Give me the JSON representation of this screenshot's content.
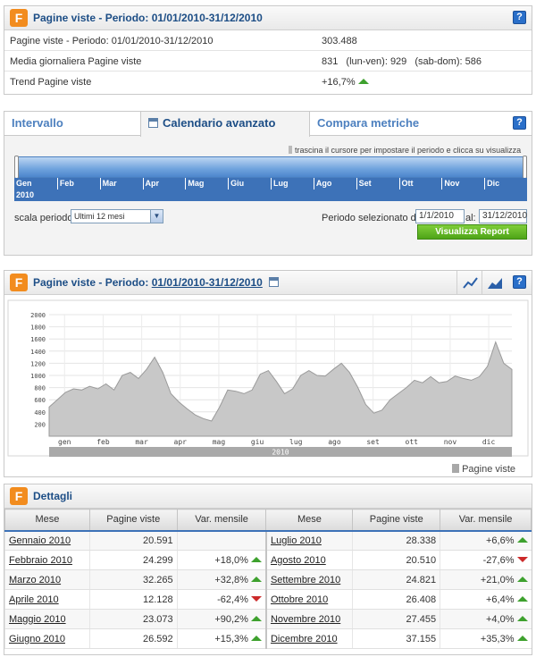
{
  "summary": {
    "title": "Pagine viste - Periodo: 01/01/2010-31/12/2010",
    "help": "?",
    "rows": [
      {
        "label": "Pagine viste - Periodo: 01/01/2010-31/12/2010",
        "value": "303.488"
      },
      {
        "label": "Media giornaliera Pagine viste",
        "value": "831",
        "weekdays": "(lun-ven): 929",
        "weekend": "(sab-dom): 586"
      },
      {
        "label": "Trend Pagine viste",
        "value": "+16,7%"
      }
    ]
  },
  "calendar": {
    "tabs": [
      "Intervallo",
      "Calendario avanzato",
      "Compara metriche"
    ],
    "help": "?",
    "hint": "trascina il cursore per impostare il periodo e clicca su visualizza report",
    "months": [
      "Gen",
      "Feb",
      "Mar",
      "Apr",
      "Mag",
      "Giu",
      "Lug",
      "Ago",
      "Set",
      "Ott",
      "Nov",
      "Dic"
    ],
    "year": "2010",
    "scale_label": "scala periodo:",
    "scale_value": "Ultimi 12 mesi",
    "period_label": "Periodo selezionato dal:",
    "date_from": "1/1/2010",
    "al_label": "al:",
    "date_to": "31/12/2010",
    "button": "Visualizza Report"
  },
  "chart_panel": {
    "title_prefix": "Pagine viste - Periodo:",
    "title_period": "01/01/2010-31/12/2010",
    "help": "?",
    "legend": "Pagine viste"
  },
  "chart_data": {
    "type": "area",
    "title": "",
    "ylim": [
      0,
      2000
    ],
    "yticks": [
      200,
      400,
      600,
      800,
      1000,
      1200,
      1400,
      1600,
      1800,
      2000
    ],
    "xtick_labels": [
      "gen",
      "feb",
      "mar",
      "apr",
      "mag",
      "giu",
      "lug",
      "ago",
      "set",
      "ott",
      "nov",
      "dic"
    ],
    "x_label_bar": "2010",
    "series": [
      {
        "name": "Pagine viste",
        "color": "#c8c8c8",
        "x_start": "2010-01-01",
        "x_step_days": 7,
        "values": [
          480,
          600,
          720,
          780,
          760,
          820,
          780,
          860,
          760,
          1000,
          1050,
          950,
          1100,
          1300,
          1050,
          700,
          560,
          450,
          350,
          290,
          250,
          480,
          760,
          740,
          700,
          760,
          1020,
          1080,
          900,
          700,
          780,
          1000,
          1080,
          1000,
          990,
          1100,
          1200,
          1050,
          810,
          520,
          380,
          430,
          600,
          700,
          800,
          920,
          880,
          980,
          880,
          900,
          990,
          950,
          920,
          980,
          1150,
          1550,
          1200,
          1100
        ]
      }
    ]
  },
  "details": {
    "title": "Dettagli",
    "headers": [
      "Mese",
      "Pagine viste",
      "Var. mensile",
      "Mese",
      "Pagine viste",
      "Var. mensile"
    ],
    "rows": [
      {
        "m1": "Gennaio 2010",
        "v1": "20.591",
        "d1": "",
        "t1": "none",
        "m2": "Luglio 2010",
        "v2": "28.338",
        "d2": "+6,6%",
        "t2": "up"
      },
      {
        "m1": "Febbraio 2010",
        "v1": "24.299",
        "d1": "+18,0%",
        "t1": "up",
        "m2": "Agosto 2010",
        "v2": "20.510",
        "d2": "-27,6%",
        "t2": "down"
      },
      {
        "m1": "Marzo 2010",
        "v1": "32.265",
        "d1": "+32,8%",
        "t1": "up",
        "m2": "Settembre 2010",
        "v2": "24.821",
        "d2": "+21,0%",
        "t2": "up"
      },
      {
        "m1": "Aprile 2010",
        "v1": "12.128",
        "d1": "-62,4%",
        "t1": "down",
        "m2": "Ottobre 2010",
        "v2": "26.408",
        "d2": "+6,4%",
        "t2": "up"
      },
      {
        "m1": "Maggio 2010",
        "v1": "23.073",
        "d1": "+90,2%",
        "t1": "up",
        "m2": "Novembre 2010",
        "v2": "27.455",
        "d2": "+4,0%",
        "t2": "up"
      },
      {
        "m1": "Giugno 2010",
        "v1": "26.592",
        "d1": "+15,3%",
        "t1": "up",
        "m2": "Dicembre 2010",
        "v2": "37.155",
        "d2": "+35,3%",
        "t2": "up"
      }
    ]
  }
}
